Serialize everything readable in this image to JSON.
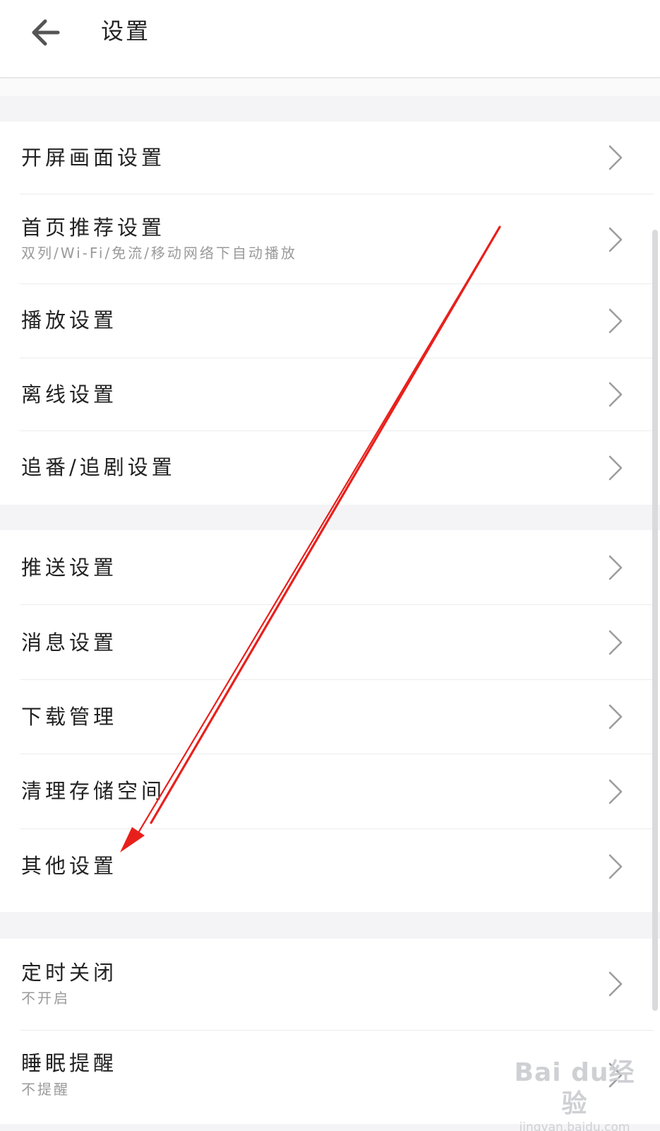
{
  "header": {
    "title": "设置",
    "back_icon": "arrow-left-icon"
  },
  "groups": [
    {
      "items": [
        {
          "title": "开屏画面设置"
        },
        {
          "title": "首页推荐设置",
          "subtitle": "双列/Wi-Fi/免流/移动网络下自动播放"
        },
        {
          "title": "播放设置"
        },
        {
          "title": "离线设置"
        },
        {
          "title": "追番/追剧设置"
        }
      ]
    },
    {
      "items": [
        {
          "title": "推送设置"
        },
        {
          "title": "消息设置"
        },
        {
          "title": "下载管理"
        },
        {
          "title": "清理存储空间"
        },
        {
          "title": "其他设置"
        }
      ]
    },
    {
      "items": [
        {
          "title": "定时关闭",
          "subtitle": "不开启"
        },
        {
          "title": "睡眠提醒",
          "subtitle": "不提醒"
        }
      ]
    }
  ],
  "watermark": {
    "logo_text": "Bai du经验",
    "url": "jingyan.baidu.com"
  },
  "colors": {
    "background": "#f4f4f6",
    "surface": "#ffffff",
    "text_primary": "#222222",
    "text_secondary": "#9a9a9c",
    "annotation_arrow": "#e8201c"
  }
}
